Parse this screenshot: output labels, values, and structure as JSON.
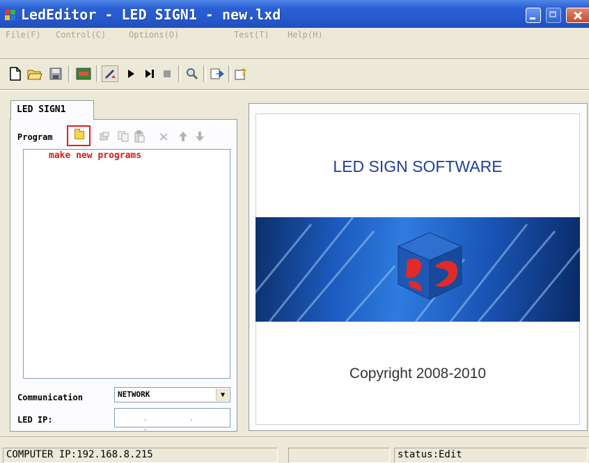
{
  "window": {
    "title": "LedEditor - LED SIGN1 - new.lxd"
  },
  "menu": {
    "items": [
      "File(F)",
      "Control(C)",
      "Options(O)",
      "Test(T)",
      "Help(H)"
    ]
  },
  "toolbar": {
    "icons": [
      "new-file-icon",
      "open-folder-icon",
      "save-icon",
      "led-screen-icon",
      "edit-pen-icon",
      "play-icon",
      "step-play-icon",
      "stop-icon",
      "zoom-icon",
      "send-icon",
      "help-icon"
    ]
  },
  "left_panel": {
    "tab_label": "LED SIGN1",
    "program_label": "Program",
    "hint": "make new programs",
    "communication_label": "Communication",
    "communication_value": "NETWORK",
    "led_ip_label": "LED IP:",
    "led_ip_value": ". . ."
  },
  "preview": {
    "title": "LED SIGN SOFTWARE",
    "copyright": "Copyright 2008-2010"
  },
  "status": {
    "computer_ip": "COMPUTER IP:192.168.8.215",
    "middle": "",
    "state": "status:Edit"
  },
  "colors": {
    "title_bar": "#2658cc",
    "preview_title": "#1e3f9a",
    "hint_text": "#d81b1b",
    "highlight_box": "#e11e1e"
  }
}
